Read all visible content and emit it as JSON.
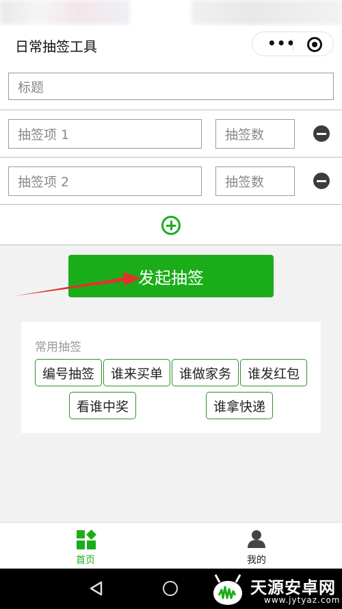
{
  "app": {
    "title": "日常抽签工具"
  },
  "form": {
    "title_placeholder": "标题",
    "items": [
      {
        "name_placeholder": "抽签项 1",
        "count_placeholder": "抽签数"
      },
      {
        "name_placeholder": "抽签项 2",
        "count_placeholder": "抽签数"
      }
    ]
  },
  "actions": {
    "start_label": "发起抽签"
  },
  "common": {
    "title": "常用抽签",
    "tags": [
      "编号抽签",
      "谁来买单",
      "谁做家务",
      "谁发红包",
      "看谁中奖",
      "谁拿快递"
    ]
  },
  "tabbar": {
    "tabs": [
      {
        "label": "首页",
        "icon": "home-grid-icon",
        "active": true
      },
      {
        "label": "我的",
        "icon": "user-icon",
        "active": false
      }
    ]
  },
  "watermark": {
    "text": "天源安卓网",
    "url": "www.jytyaz.com"
  },
  "colors": {
    "accent": "#1aad19",
    "annotation_arrow": "#e0342b"
  }
}
